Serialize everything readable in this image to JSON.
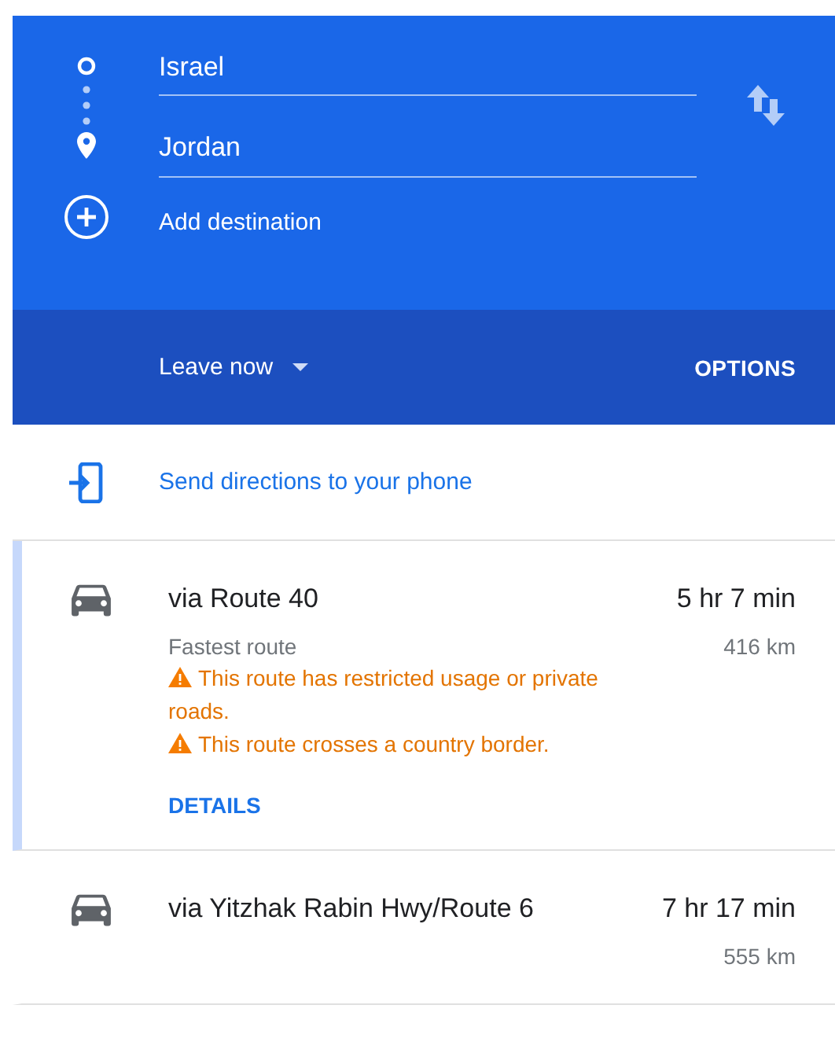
{
  "directions": {
    "origin": "Israel",
    "destination": "Jordan",
    "add_destination": "Add destination"
  },
  "departure": {
    "time_option": "Leave now",
    "options_button": "OPTIONS"
  },
  "send_to_phone": "Send directions to your phone",
  "routes": [
    {
      "title": "via Route 40",
      "duration": "5 hr 7 min",
      "distance": "416 km",
      "description": "Fastest route",
      "warnings": [
        "This route has restricted usage or private roads.",
        "This route crosses a country border."
      ],
      "details_link": "DETAILS",
      "selected": true
    },
    {
      "title": "via Yitzhak Rabin Hwy/Route 6",
      "duration": "7 hr 17 min",
      "distance": "555 km",
      "selected": false
    }
  ]
}
